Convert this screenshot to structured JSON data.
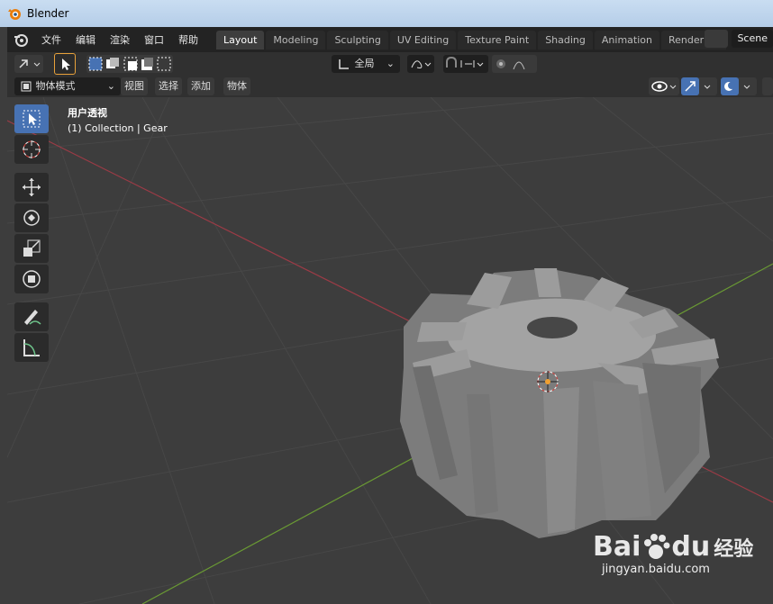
{
  "window": {
    "title": "Blender"
  },
  "menu": {
    "items": [
      "文件",
      "编辑",
      "渲染",
      "窗口",
      "帮助"
    ]
  },
  "tabs": [
    "Layout",
    "Modeling",
    "Sculpting",
    "UV Editing",
    "Texture Paint",
    "Shading",
    "Animation",
    "Rendering"
  ],
  "active_tab": "Layout",
  "scene": {
    "label": "Scene"
  },
  "toolbar": {
    "transform_orientation": "全局"
  },
  "header": {
    "mode": "物体模式",
    "view": "视图",
    "select": "选择",
    "add": "添加",
    "object": "物体"
  },
  "viewport": {
    "view_name": "用户透视",
    "collection": "(1) Collection | Gear"
  },
  "tools": [
    "select-box-icon",
    "cursor-icon",
    "move-icon",
    "rotate-icon",
    "scale-icon",
    "transform-icon",
    "annotate-icon",
    "measure-icon"
  ],
  "watermark": {
    "brand": "Bai",
    "brand2": "du",
    "brand3": "经验",
    "url": "jingyan.baidu.com"
  },
  "colors": {
    "accent": "#4772b3",
    "x_axis": "#9c3b46",
    "y_axis": "#6a9a34",
    "gear": "#8e8e8e"
  }
}
